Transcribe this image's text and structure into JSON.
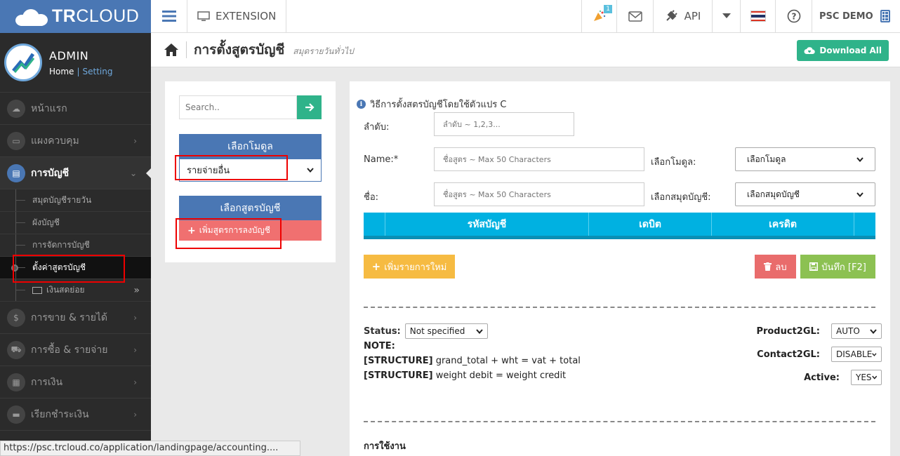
{
  "brand": {
    "logo_text_bold": "TR",
    "logo_text": "CLOUD"
  },
  "topbar": {
    "extension_label": "EXTENSION",
    "notification_count": "1",
    "api_label": "API",
    "user_label": "PSC DEMO"
  },
  "profile": {
    "name": "ADMIN",
    "home_link": "Home",
    "separator": "|",
    "setting_link": "Setting"
  },
  "sidebar": {
    "items": [
      {
        "label": "หน้าแรก"
      },
      {
        "label": "แผงควบคุม"
      },
      {
        "label": "การบัญชี"
      },
      {
        "label": "การขาย & รายได้"
      },
      {
        "label": "การซื้อ & รายจ่าย"
      },
      {
        "label": "การเงิน"
      },
      {
        "label": "เรียกชำระเงิน"
      }
    ],
    "sub_items": [
      {
        "label": "สมุดบัญชีรายวัน"
      },
      {
        "label": "ผังบัญชี"
      },
      {
        "label": "การจัดการบัญชี"
      },
      {
        "label": "ตั้งค่าสูตรบัญชี"
      },
      {
        "label": "เงินสดย่อย"
      }
    ]
  },
  "statusbar": {
    "url": "https://psc.trcloud.co/application/landingpage/accounting...."
  },
  "page": {
    "title": "การตั้งสูตรบัญชี",
    "subtitle": "สมุดรายวันทั่วไป",
    "download_all": "Download All"
  },
  "left_panel": {
    "search_placeholder": "Search..",
    "module_header": "เลือกโมดูล",
    "module_selected": "รายจ่ายอื่น",
    "formula_header": "เลือกสูตรบัญชี",
    "add_formula": "เพิ่มสูตรการลงบัญชี"
  },
  "form": {
    "info_text": "วิธีการตั้งสตรบัญชีโดยใช้ตัวแปร C",
    "order_label": "ลำดับ:",
    "order_placeholder": "ลำดับ ~ 1,2,3...",
    "name_label": "Name:*",
    "name_placeholder": "ชื่อสูตร ~ Max 50 Characters",
    "module_label": "เลือกโมดูล:",
    "module_value": "เลือกโมดูล",
    "thai_name_label": "ชื่อ:",
    "thai_name_placeholder": "ชื่อสูตร ~ Max 50 Characters",
    "book_label": "เลือกสมุดบัญชี:",
    "book_value": "เลือกสมุดบัญชี",
    "table_headers": [
      "",
      "รหัสบัญชี",
      "เดบิต",
      "เครดิต",
      ""
    ],
    "add_row": "เพิ่มรายการใหม่",
    "delete": "ลบ",
    "save": "บันทึก [F2]",
    "status_label": "Status:",
    "status_value": "Not specified",
    "note_label": "NOTE:",
    "structure_1_tag": "[STRUCTURE]",
    "structure_1_text": "grand_total + wht = vat + total",
    "structure_2_tag": "[STRUCTURE]",
    "structure_2_text": "weight debit = weight credit",
    "product2gl_label": "Product2GL:",
    "product2gl_value": "AUTO",
    "contact2gl_label": "Contact2GL:",
    "contact2gl_value": "DISABLE",
    "active_label": "Active:",
    "active_value": "YES",
    "usage_label": "การใช้งาน"
  },
  "colors": {
    "brand": "#4a77b4",
    "success": "#2fb38a",
    "danger": "#e96c6c",
    "warning": "#f6bb42",
    "save": "#8cc152",
    "table_header": "#00b1e1"
  }
}
